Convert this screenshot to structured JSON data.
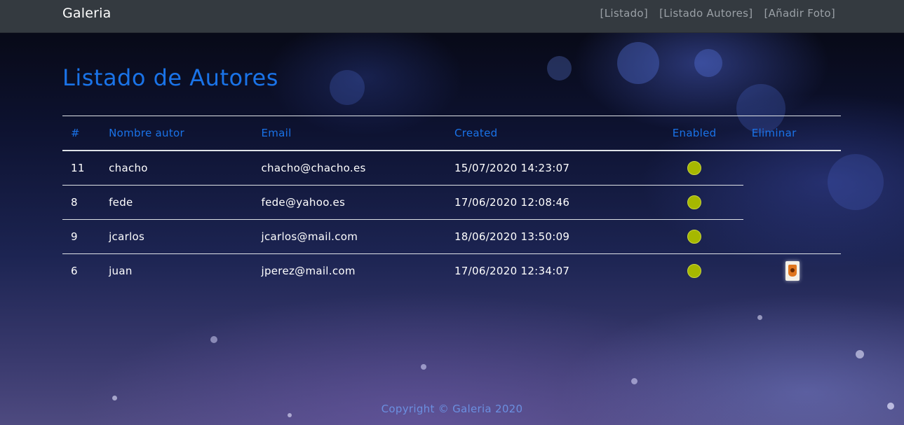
{
  "navbar": {
    "brand": "Galeria",
    "links": [
      "[Listado]",
      "[Listado Autores]",
      "[Añadir Foto]"
    ]
  },
  "main": {
    "title": "Listado de Autores",
    "table": {
      "headers": [
        "#",
        "Nombre autor",
        "Email",
        "Created",
        "Enabled",
        "Eliminar"
      ],
      "rows": [
        {
          "id": "11",
          "name": "chacho",
          "email": "chacho@chacho.es",
          "created": "15/07/2020 14:23:07",
          "enabled": true,
          "deletable": false
        },
        {
          "id": "8",
          "name": "fede",
          "email": "fede@yahoo.es",
          "created": "17/06/2020 12:08:46",
          "enabled": true,
          "deletable": false
        },
        {
          "id": "9",
          "name": "jcarlos",
          "email": "jcarlos@mail.com",
          "created": "18/06/2020 13:50:09",
          "enabled": true,
          "deletable": false
        },
        {
          "id": "6",
          "name": "juan",
          "email": "jperez@mail.com",
          "created": "17/06/2020 12:34:07",
          "enabled": true,
          "deletable": true
        }
      ]
    }
  },
  "icons": {
    "enabled": "enabled-status-icon",
    "delete": "trash-icon"
  },
  "colors": {
    "accent": "#1a73e8",
    "enabled_dot": "#a6b800",
    "navbar_bg": "#343a40"
  },
  "footer": {
    "text": "Copyright © Galeria 2020"
  }
}
